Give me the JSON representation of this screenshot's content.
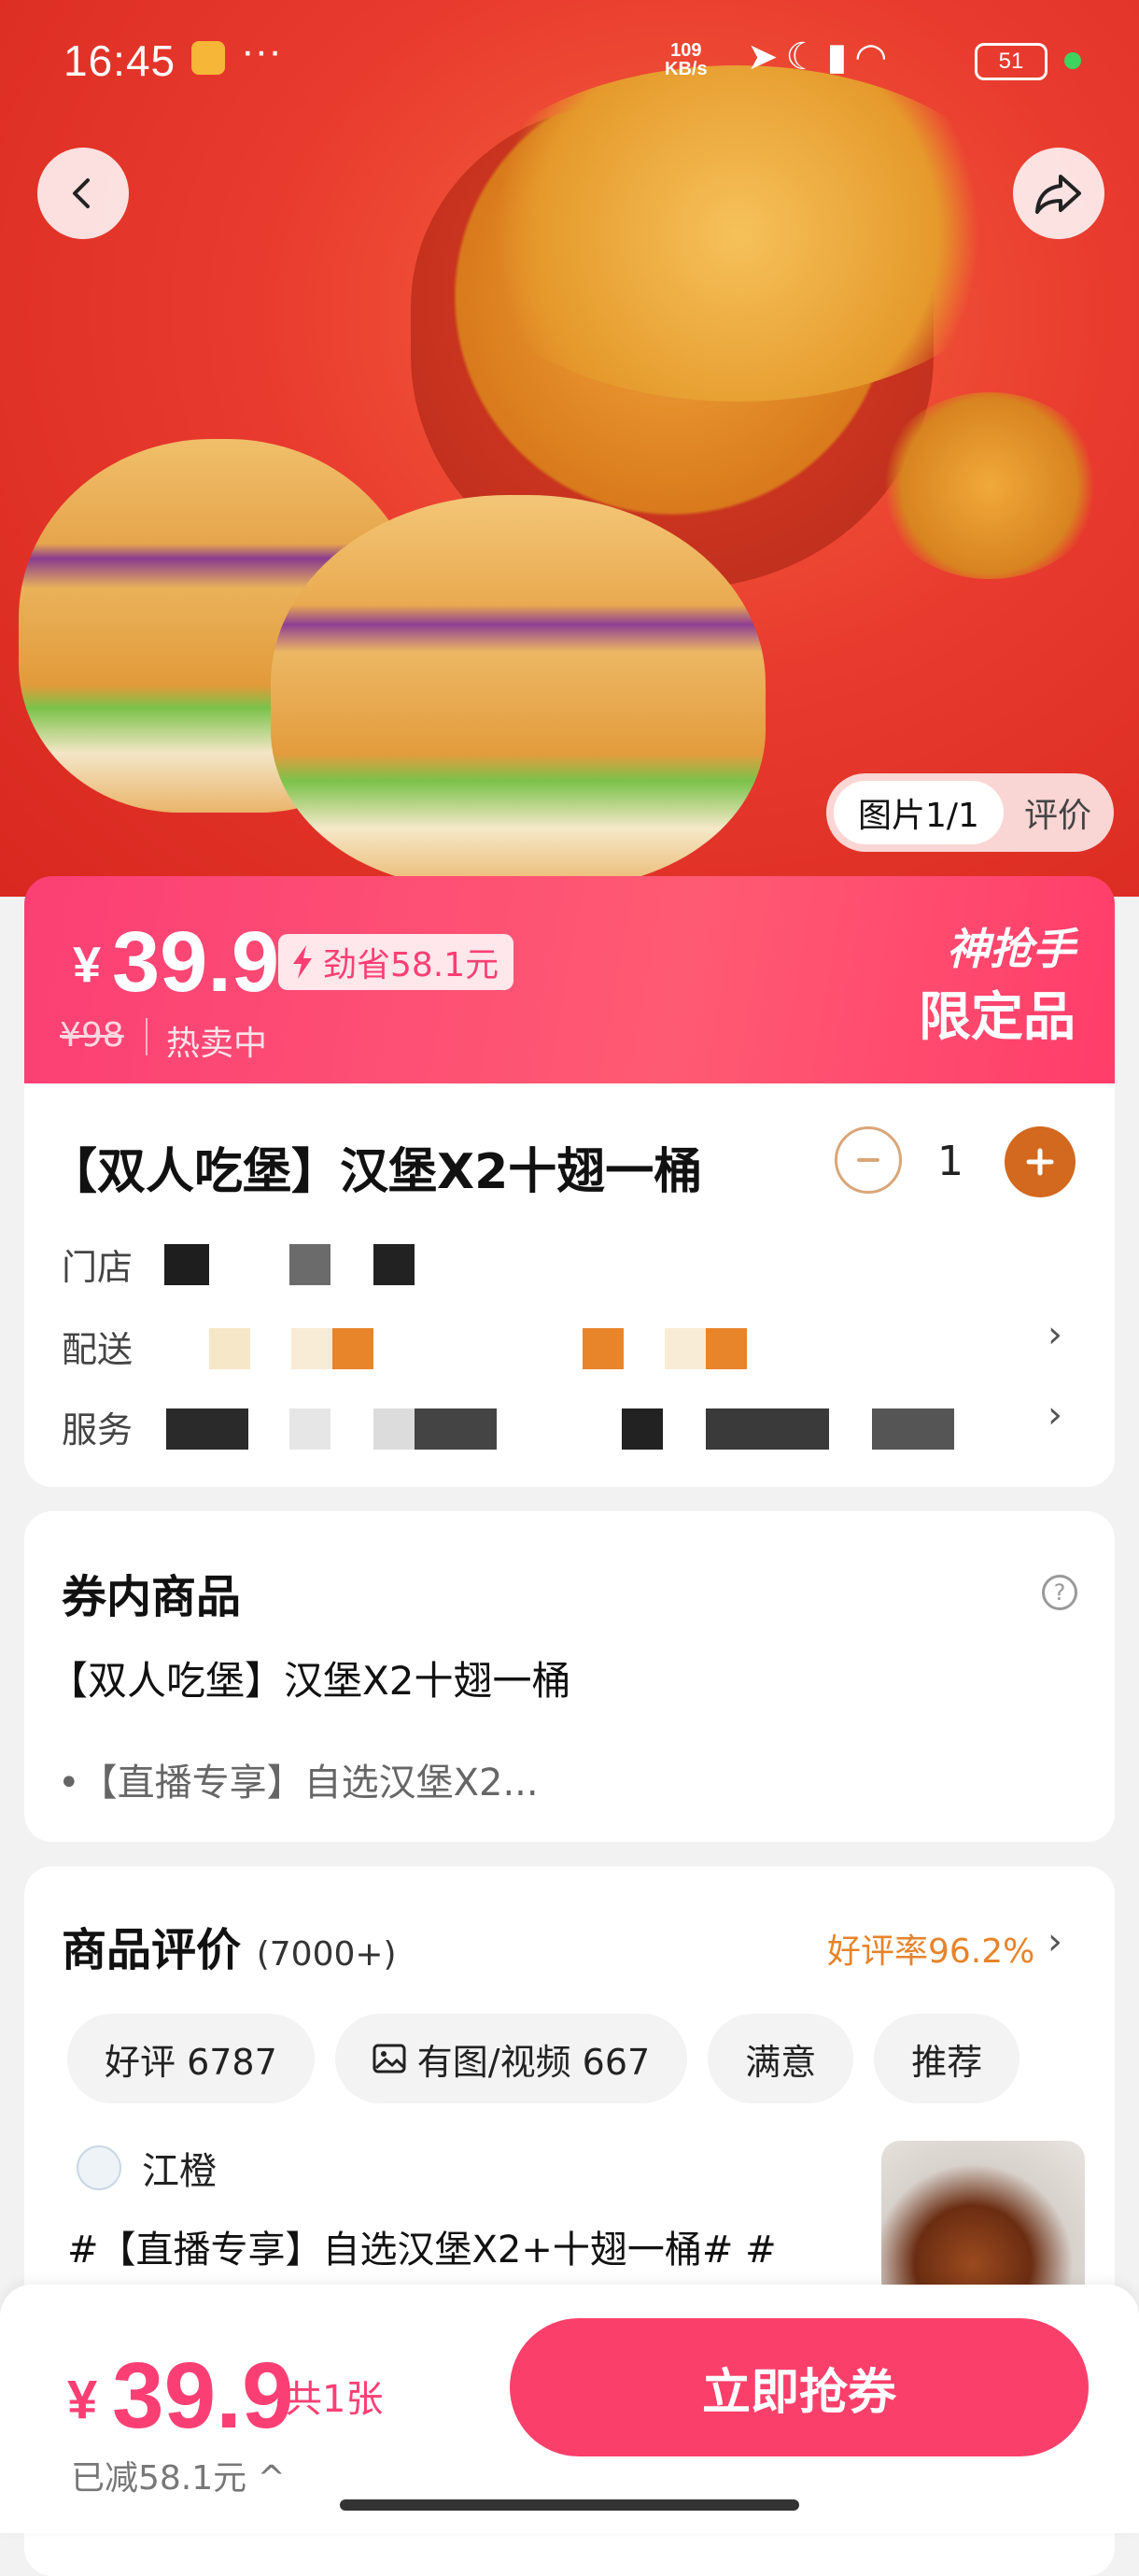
{
  "status_bar": {
    "time": "16:45",
    "speed": "109",
    "speed_unit": "KB/s",
    "battery": "51",
    "icons": [
      "location-icon",
      "moon-icon",
      "signal-icon",
      "wifi-icon"
    ]
  },
  "hero": {
    "tab_active": "图片1/1",
    "tab_other": "评价",
    "accent_bg": "#e83a2e"
  },
  "price_banner": {
    "currency": "¥",
    "price": "39.9",
    "savings": "劲省58.1元",
    "original_price": "¥98",
    "status": "热卖中",
    "brand_label": "神抢手",
    "limited_label": "限定品",
    "color": "#fb3f74"
  },
  "product": {
    "title": "【双人吃堡】汉堡X2十翅一桶",
    "quantity": "1",
    "rows": [
      {
        "label": "门店"
      },
      {
        "label": "配送"
      },
      {
        "label": "服务"
      }
    ]
  },
  "coupon_items": {
    "title": "券内商品",
    "item": "【双人吃堡】汉堡X2十翅一桶",
    "sub_item": "•【直播专享】自选汉堡X2..."
  },
  "reviews": {
    "title": "商品评价",
    "count": "(7000+)",
    "rating": "好评率96.2%",
    "chips": [
      {
        "label": "好评 6787"
      },
      {
        "label": "有图/视频 667"
      },
      {
        "label": "满意"
      },
      {
        "label": "推荐"
      }
    ],
    "first_review": {
      "author": "江橙",
      "text": "#【直播专享】自选汉堡X2+十翅一桶# #"
    }
  },
  "bottom_bar": {
    "currency": "¥",
    "price": "39.9",
    "count": "共1张",
    "discount": "已减58.1元 ^",
    "buy_label": "立即抢券",
    "accent": "#fb3f6b"
  }
}
